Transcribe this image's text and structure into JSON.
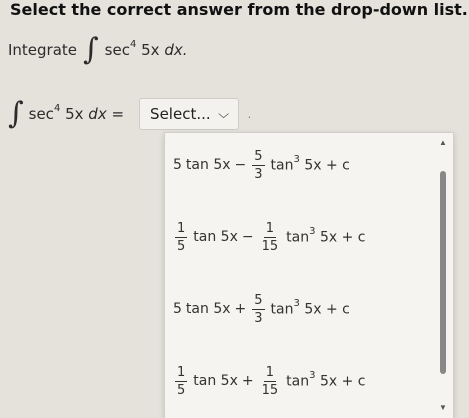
{
  "instruction": "Select the correct answer from the drop-down list.",
  "question": {
    "prefix": "Integrate",
    "integrand_sec": "sec",
    "power": "4",
    "integrand_rest": "5x",
    "dx": "dx."
  },
  "equation": {
    "lhs_sec": "sec",
    "lhs_power": "4",
    "lhs_rest": "5x",
    "lhs_dx": "dx =",
    "select_label": "Select...",
    "trailing": "."
  },
  "options": [
    {
      "coef1": "5",
      "term1": "tan 5x",
      "op": "−",
      "frac2_num": "5",
      "frac2_den": "3",
      "term2": "tan",
      "power2": "3",
      "term2_rest": "5x + c"
    },
    {
      "frac1_num": "1",
      "frac1_den": "5",
      "term1": "tan 5x",
      "op": "−",
      "frac2_num": "1",
      "frac2_den": "15",
      "term2": "tan",
      "power2": "3",
      "term2_rest": "5x + c"
    },
    {
      "coef1": "5",
      "term1": "tan 5x",
      "op": "+",
      "frac2_num": "5",
      "frac2_den": "3",
      "term2": "tan",
      "power2": "3",
      "term2_rest": "5x + c"
    },
    {
      "frac1_num": "1",
      "frac1_den": "5",
      "term1": "tan 5x",
      "op": "+",
      "frac2_num": "1",
      "frac2_den": "15",
      "term2": "tan",
      "power2": "3",
      "term2_rest": "5x + c"
    }
  ],
  "icons": {
    "chevron": "chevron-down-icon",
    "scroll_up": "triangle-up-icon",
    "scroll_down": "triangle-down-icon"
  }
}
